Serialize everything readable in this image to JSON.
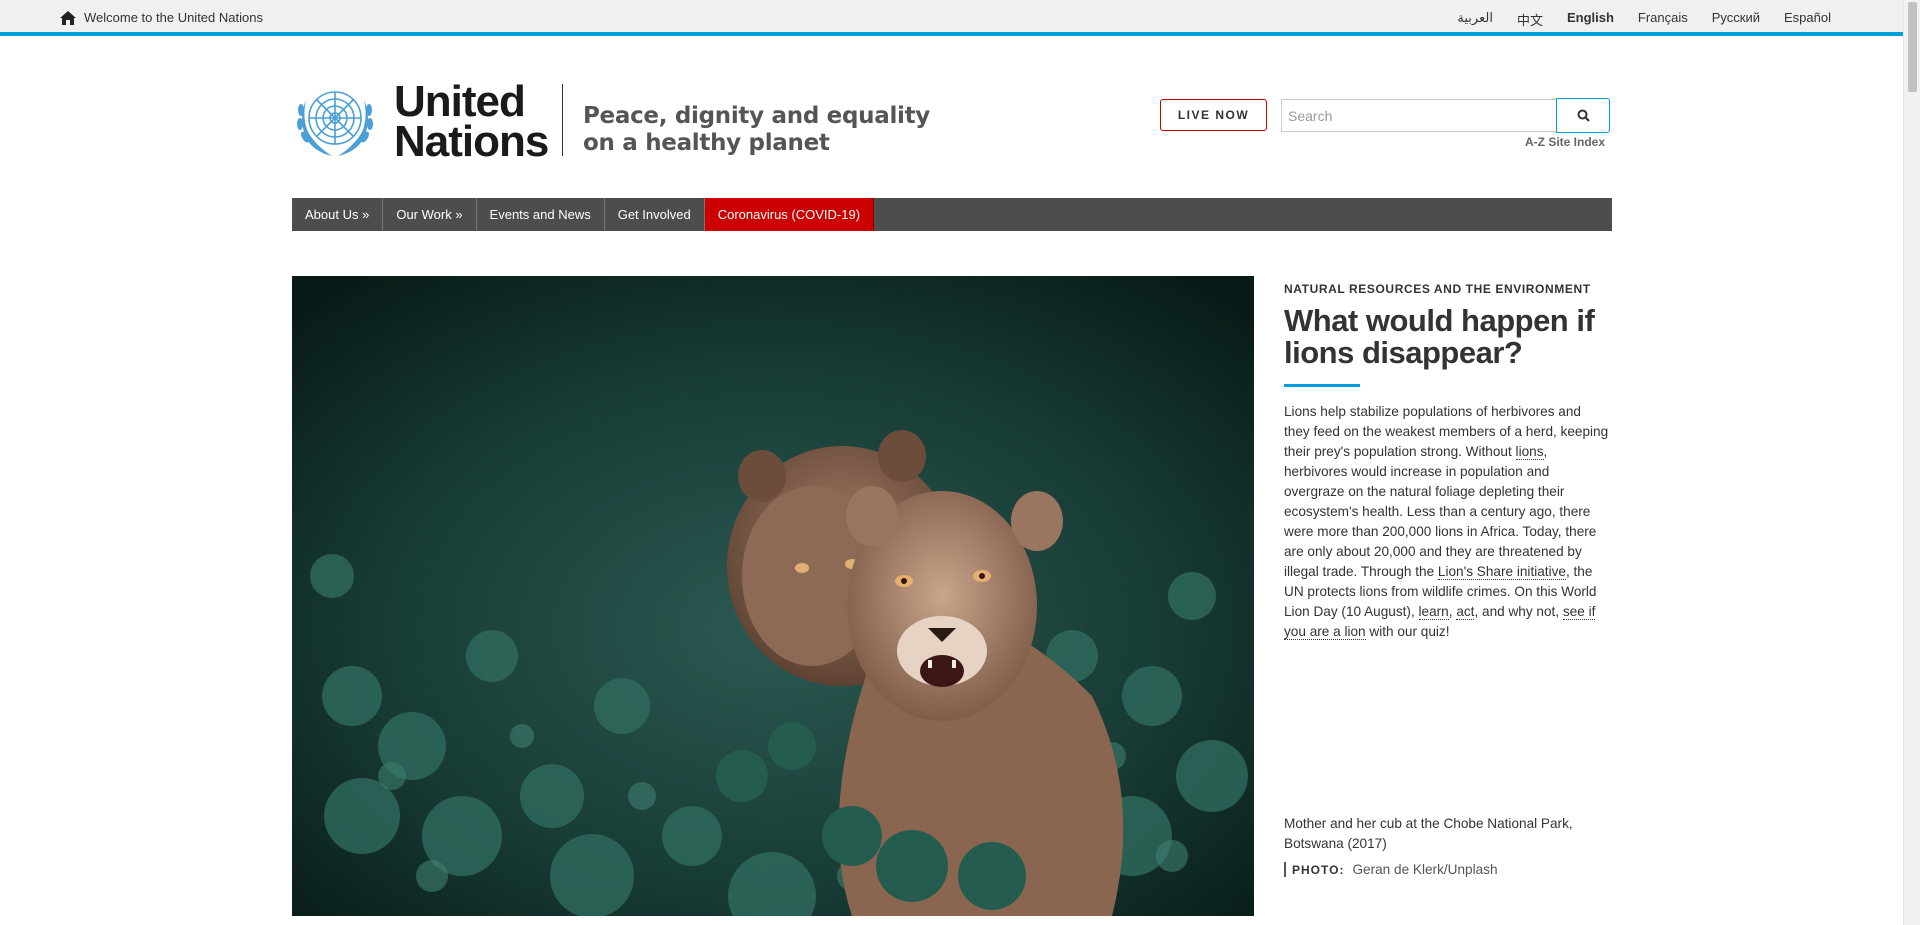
{
  "topbar": {
    "welcome": "Welcome to the United Nations",
    "languages": [
      "العربية",
      "中文",
      "English",
      "Français",
      "Русский",
      "Español"
    ],
    "active_language": "English"
  },
  "header": {
    "brand_line1": "United",
    "brand_line2": "Nations",
    "tagline_line1": "Peace, dignity and equality",
    "tagline_line2": "on a healthy planet",
    "live_label": "LIVE NOW",
    "search_placeholder": "Search",
    "az_index": "A-Z Site Index"
  },
  "nav": {
    "items": [
      "About Us »",
      "Our Work »",
      "Events and News",
      "Get Involved",
      "Coronavirus (COVID-19)"
    ]
  },
  "article": {
    "kicker": "NATURAL RESOURCES AND THE ENVIRONMENT",
    "headline": "What would happen if lions disappear?",
    "body_1": "Lions help stabilize populations of herbivores and they feed on the weakest members of a herd, keeping their prey's population strong. Without ",
    "link_lions": "lions",
    "body_2": ", herbivores would increase in population and overgraze on the natural foliage depleting their ecosystem's health. Less than a century ago, there were more than 200,000 lions in Africa. Today, there are only about 20,000 and they are threatened by illegal trade. Through the ",
    "link_share": "Lion's Share initiative",
    "body_3": ", the UN protects lions from wildlife crimes. On this World Lion Day (10 August), ",
    "link_learn": "learn",
    "body_4": ", ",
    "link_act": "act",
    "body_5": ", and why not, ",
    "link_quiz": "see if you are a lion",
    "body_6": " with our quiz!",
    "caption": "Mother and her cub at the Chobe National Park, Botswana (2017)",
    "credit_label": "PHOTO:",
    "credit_name": "Geran de Klerk/Unplash"
  },
  "colors": {
    "accent": "#009edb",
    "nav_bg": "#4d4d4d",
    "covid_red": "#cc0000"
  },
  "icons": [
    "home-icon",
    "un-emblem-logo",
    "search-icon"
  ]
}
